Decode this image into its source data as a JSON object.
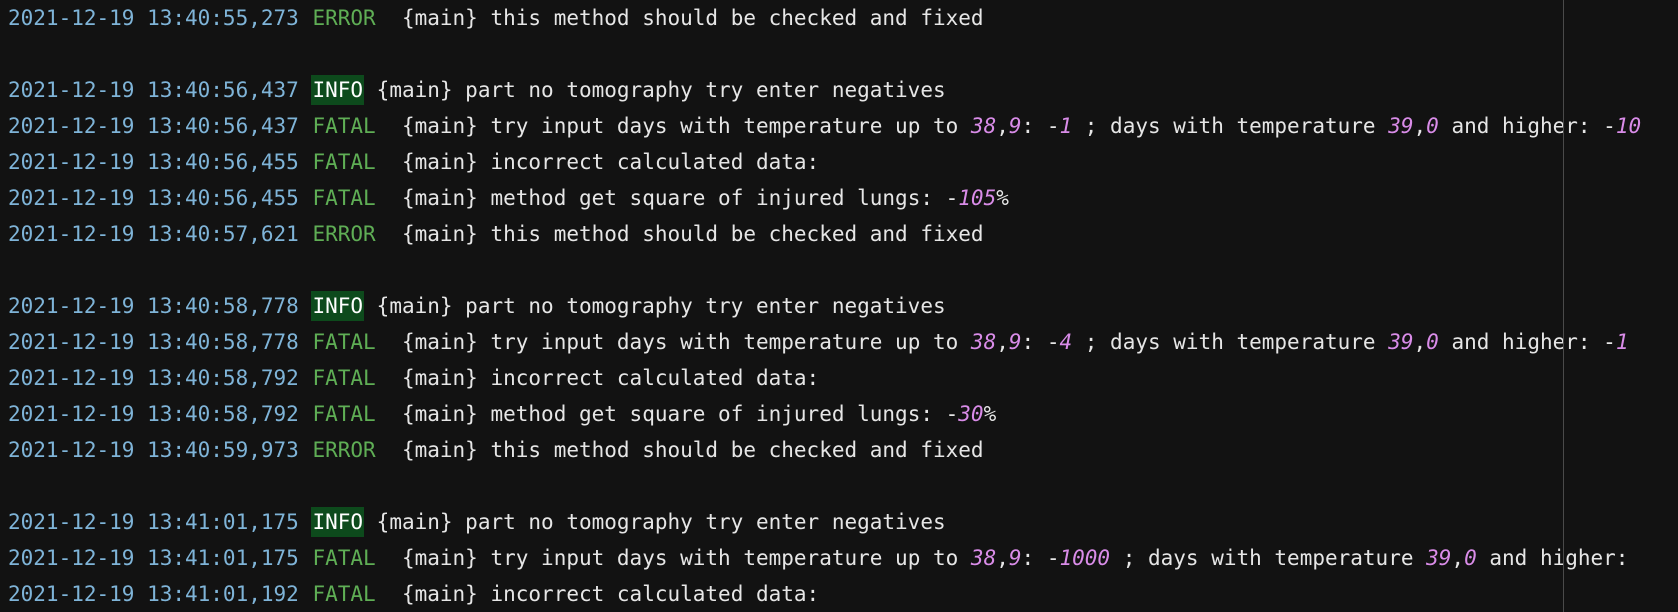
{
  "colors": {
    "background": "#121212",
    "timestamp": "#7fb4d8",
    "level_green": "#5fae55",
    "info_bg": "#0d4a1c",
    "number": "#d98ce8",
    "text": "#e6e6e6"
  },
  "lines": [
    {
      "ts": "2021-12-19 13:40:55,273",
      "level": "ERROR",
      "parts": [
        {
          "t": " {main} this method should be checked and fixed"
        }
      ]
    },
    {
      "blank": true
    },
    {
      "ts": "2021-12-19 13:40:56,437",
      "level": "INFO",
      "parts": [
        {
          "t": " {main} part no tomography try enter negatives"
        }
      ]
    },
    {
      "ts": "2021-12-19 13:40:56,437",
      "level": "FATAL",
      "parts": [
        {
          "t": " {main} try input days with temperature up to "
        },
        {
          "t": "38",
          "n": true
        },
        {
          "t": ","
        },
        {
          "t": "9",
          "n": true
        },
        {
          "t": ": -"
        },
        {
          "t": "1",
          "n": true
        },
        {
          "t": " ; days with temperature "
        },
        {
          "t": "39",
          "n": true
        },
        {
          "t": ","
        },
        {
          "t": "0",
          "n": true
        },
        {
          "t": " and higher: -"
        },
        {
          "t": "10",
          "n": true
        }
      ]
    },
    {
      "ts": "2021-12-19 13:40:56,455",
      "level": "FATAL",
      "parts": [
        {
          "t": " {main} incorrect calculated data:"
        }
      ]
    },
    {
      "ts": "2021-12-19 13:40:56,455",
      "level": "FATAL",
      "parts": [
        {
          "t": " {main} method get square of injured lungs: -"
        },
        {
          "t": "105",
          "n": true
        },
        {
          "t": "%"
        }
      ]
    },
    {
      "ts": "2021-12-19 13:40:57,621",
      "level": "ERROR",
      "parts": [
        {
          "t": " {main} this method should be checked and fixed"
        }
      ]
    },
    {
      "blank": true
    },
    {
      "ts": "2021-12-19 13:40:58,778",
      "level": "INFO",
      "parts": [
        {
          "t": " {main} part no tomography try enter negatives"
        }
      ]
    },
    {
      "ts": "2021-12-19 13:40:58,778",
      "level": "FATAL",
      "parts": [
        {
          "t": " {main} try input days with temperature up to "
        },
        {
          "t": "38",
          "n": true
        },
        {
          "t": ","
        },
        {
          "t": "9",
          "n": true
        },
        {
          "t": ": -"
        },
        {
          "t": "4",
          "n": true
        },
        {
          "t": " ; days with temperature "
        },
        {
          "t": "39",
          "n": true
        },
        {
          "t": ","
        },
        {
          "t": "0",
          "n": true
        },
        {
          "t": " and higher: -"
        },
        {
          "t": "1",
          "n": true
        }
      ]
    },
    {
      "ts": "2021-12-19 13:40:58,792",
      "level": "FATAL",
      "parts": [
        {
          "t": " {main} incorrect calculated data:"
        }
      ]
    },
    {
      "ts": "2021-12-19 13:40:58,792",
      "level": "FATAL",
      "parts": [
        {
          "t": " {main} method get square of injured lungs: -"
        },
        {
          "t": "30",
          "n": true
        },
        {
          "t": "%"
        }
      ]
    },
    {
      "ts": "2021-12-19 13:40:59,973",
      "level": "ERROR",
      "parts": [
        {
          "t": " {main} this method should be checked and fixed"
        }
      ]
    },
    {
      "blank": true
    },
    {
      "ts": "2021-12-19 13:41:01,175",
      "level": "INFO",
      "parts": [
        {
          "t": " {main} part no tomography try enter negatives"
        }
      ]
    },
    {
      "ts": "2021-12-19 13:41:01,175",
      "level": "FATAL",
      "parts": [
        {
          "t": " {main} try input days with temperature up to "
        },
        {
          "t": "38",
          "n": true
        },
        {
          "t": ","
        },
        {
          "t": "9",
          "n": true
        },
        {
          "t": ": -"
        },
        {
          "t": "1000",
          "n": true
        },
        {
          "t": " ; days with temperature "
        },
        {
          "t": "39",
          "n": true
        },
        {
          "t": ","
        },
        {
          "t": "0",
          "n": true
        },
        {
          "t": " and higher:"
        }
      ]
    },
    {
      "ts": "2021-12-19 13:41:01,192",
      "level": "FATAL",
      "parts": [
        {
          "t": " {main} incorrect calculated data:"
        }
      ]
    }
  ]
}
